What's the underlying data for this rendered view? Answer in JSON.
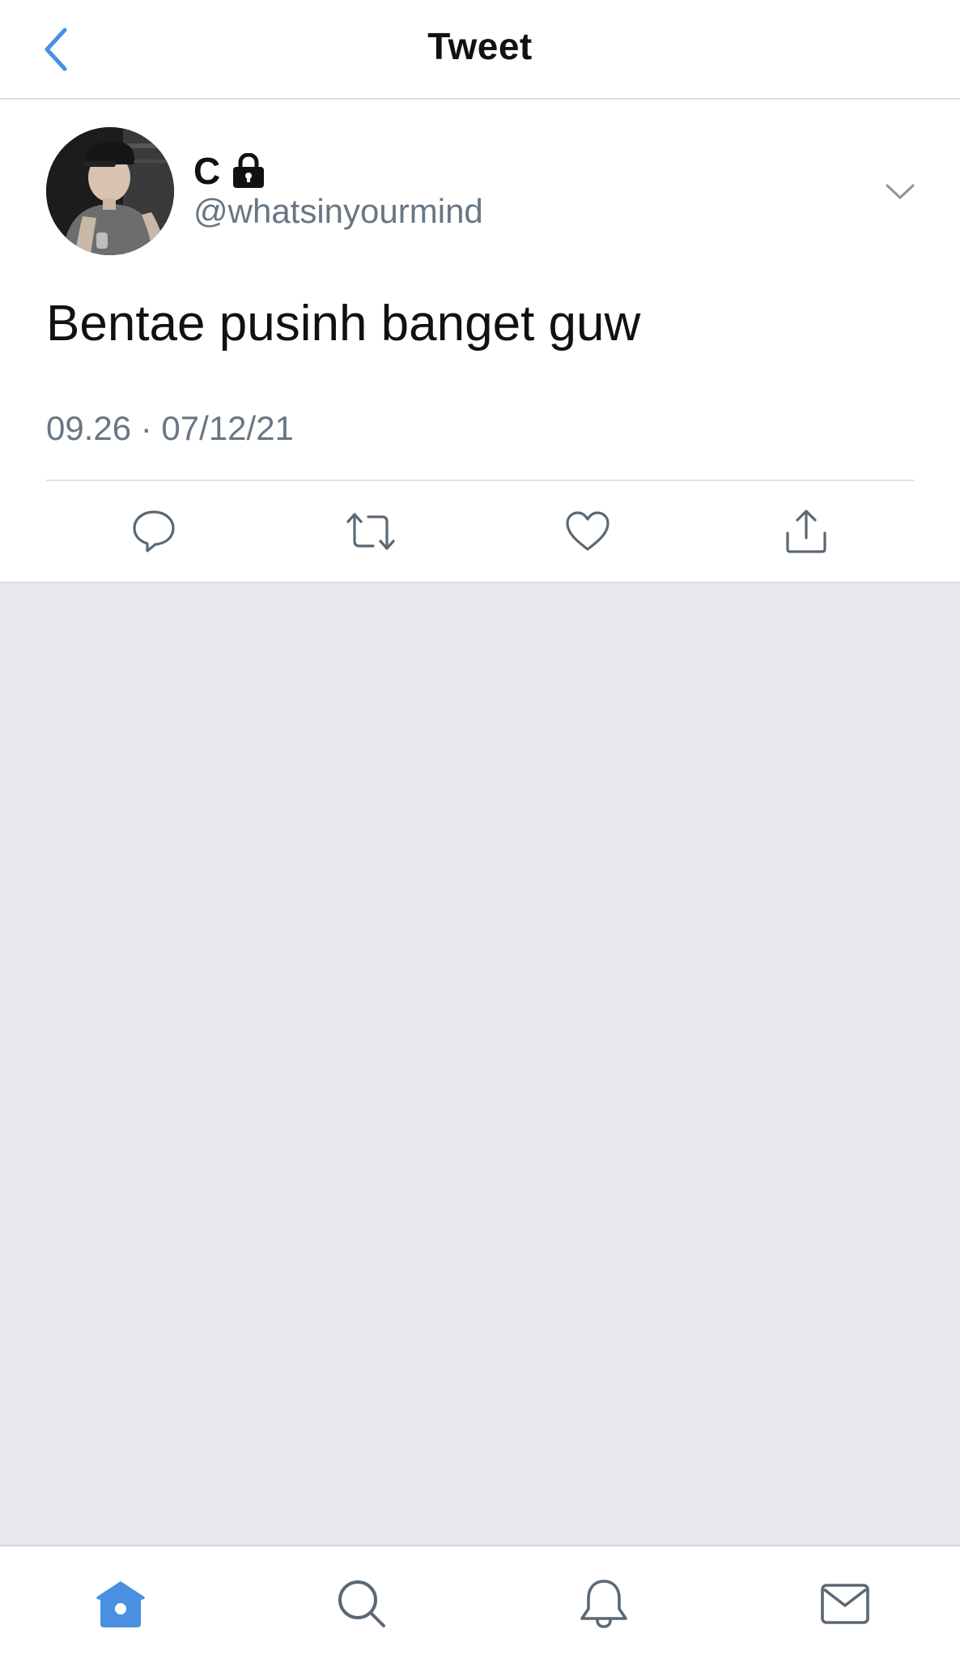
{
  "header": {
    "title": "Tweet",
    "back_icon": "back-chevron-icon"
  },
  "tweet": {
    "display_name": "C",
    "locked_icon": "lock-icon",
    "handle": "@whatsinyourmind",
    "text": "Bentae pusinh banget guw",
    "timestamp": "09.26 · 07/12/21",
    "actions": [
      {
        "name": "reply",
        "icon": "reply-bubble-icon"
      },
      {
        "name": "retweet",
        "icon": "retweet-icon"
      },
      {
        "name": "like",
        "icon": "heart-icon"
      },
      {
        "name": "share",
        "icon": "share-icon"
      }
    ]
  },
  "tabbar": {
    "tabs": [
      {
        "name": "home",
        "icon": "home-icon",
        "active": true
      },
      {
        "name": "search",
        "icon": "search-icon",
        "active": false
      },
      {
        "name": "notifications",
        "icon": "bell-icon",
        "active": false
      },
      {
        "name": "messages",
        "icon": "mail-icon",
        "active": false
      }
    ]
  },
  "colors": {
    "accent": "#4a90e2",
    "muted": "#687684",
    "background": "#e8e9ee",
    "text": "#111111"
  }
}
